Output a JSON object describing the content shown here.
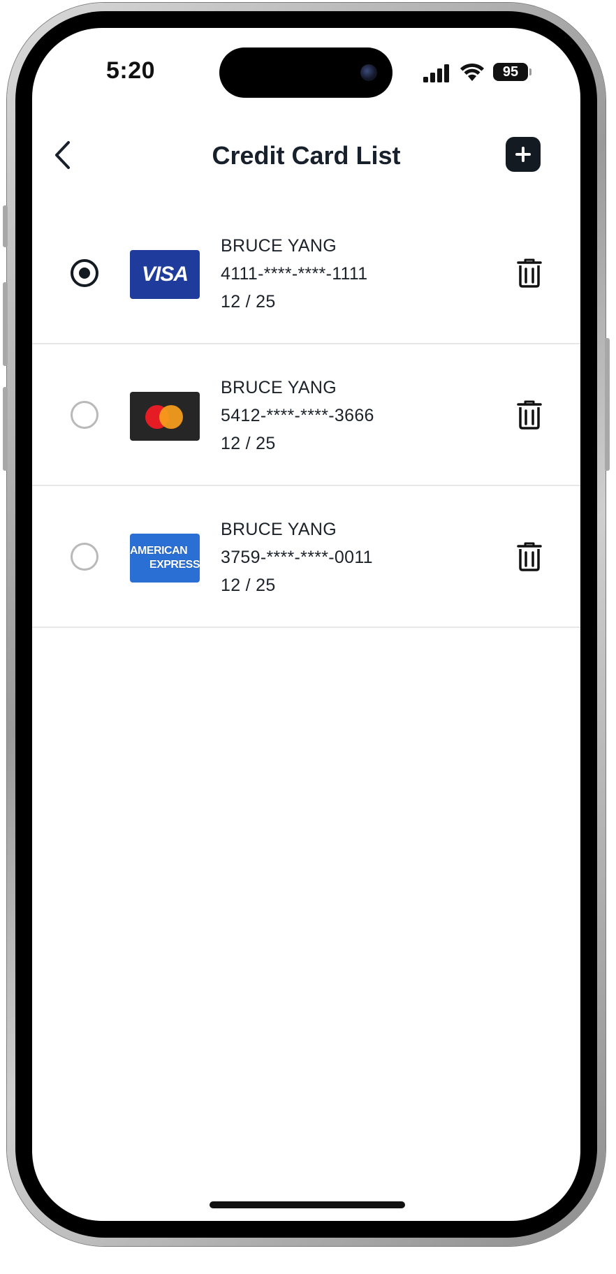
{
  "status_bar": {
    "time": "5:20",
    "battery": "95",
    "signal_icon": "signal-bars-icon",
    "wifi_icon": "wifi-icon"
  },
  "header": {
    "title": "Credit Card List",
    "back_icon": "chevron-left-icon",
    "add_icon": "plus-icon"
  },
  "cards": [
    {
      "brand": "visa",
      "brand_label": "VISA",
      "name": "BRUCE YANG",
      "number": "4111-****-****-1111",
      "expiry": "12 / 25",
      "selected": true
    },
    {
      "brand": "mastercard",
      "name": "BRUCE YANG",
      "number": "5412-****-****-3666",
      "expiry": "12 / 25",
      "selected": false
    },
    {
      "brand": "amex",
      "brand_label_line1": "AMERICAN",
      "brand_label_line2": "EXPRESS",
      "name": "BRUCE YANG",
      "number": "3759-****-****-0011",
      "expiry": "12 / 25",
      "selected": false
    }
  ],
  "colors": {
    "accent": "#141a22",
    "visa": "#1f3c9c",
    "mastercard_bg": "#262626",
    "amex": "#2a6fd3",
    "divider": "#e6e7e9"
  }
}
